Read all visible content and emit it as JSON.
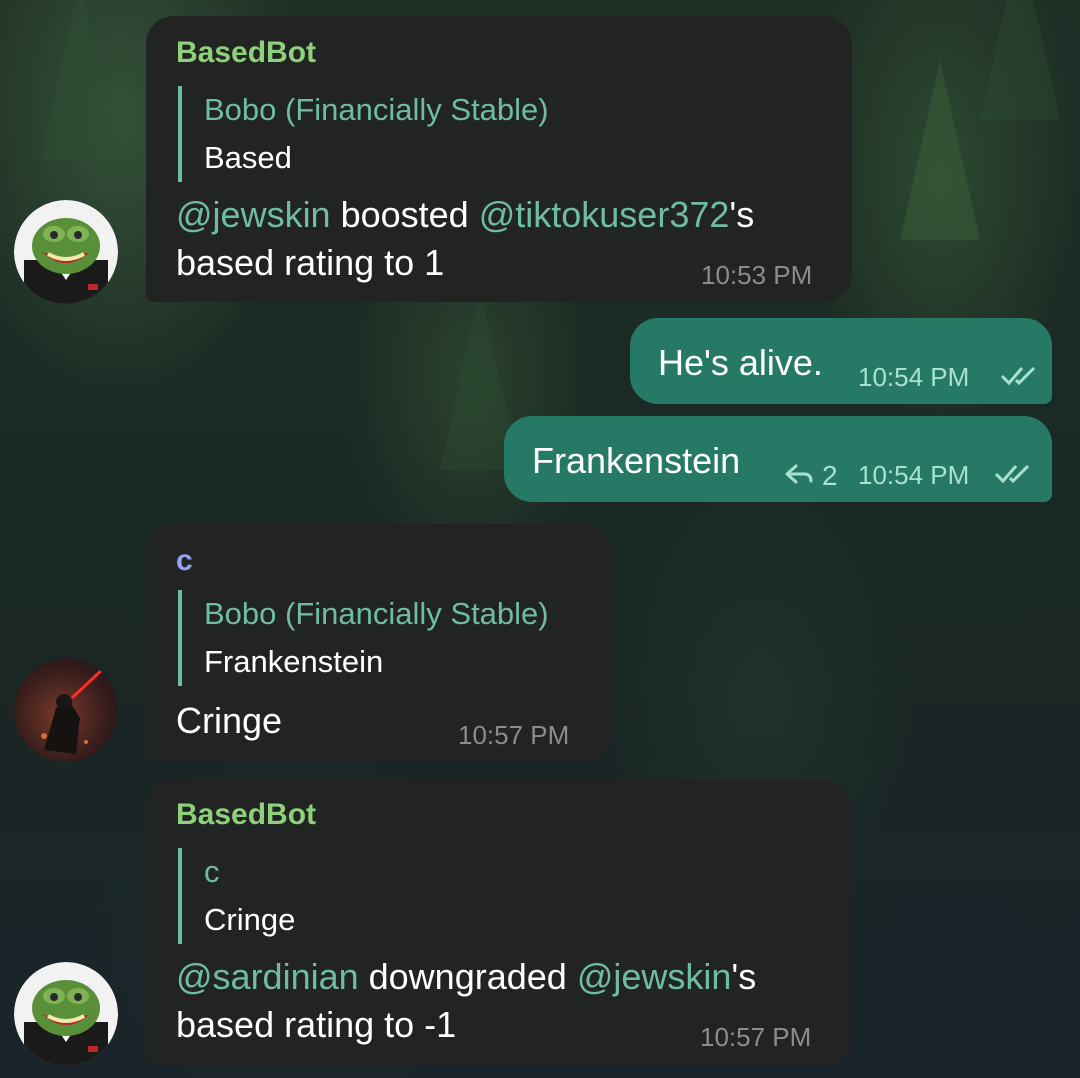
{
  "messages": [
    {
      "sender": "BasedBot",
      "quote_name": "Bobo (Financially Stable)",
      "quote_text": "Based",
      "mention_a": "@jewskin",
      "text_a": " boosted ",
      "mention_b": "@tiktokuser372",
      "text_b": "'s",
      "line2": "based rating to 1",
      "time": "10:53 PM"
    },
    {
      "text": "He's alive.",
      "time": "10:54 PM"
    },
    {
      "text": "Frankenstein",
      "reply_count": "2",
      "time": "10:54 PM"
    },
    {
      "sender": "c",
      "quote_name": "Bobo (Financially Stable)",
      "quote_text": "Frankenstein",
      "text": "Cringe",
      "time": "10:57 PM"
    },
    {
      "sender": "BasedBot",
      "quote_name": "c",
      "quote_text": "Cringe",
      "mention_a": "@sardinian",
      "text_a": " downgraded ",
      "mention_b": "@jewskin",
      "text_b": "'s",
      "line2": "based rating to -1",
      "time": "10:57 PM"
    }
  ],
  "colors": {
    "incoming_bubble": "#222323",
    "outgoing_bubble": "#267a65",
    "bot_name": "#8fd07a",
    "user_c_name": "#9aa0f0",
    "mention": "#6fbca4"
  },
  "icons": {
    "read_receipt": "double-check-icon",
    "reply": "reply-arrow-icon"
  }
}
